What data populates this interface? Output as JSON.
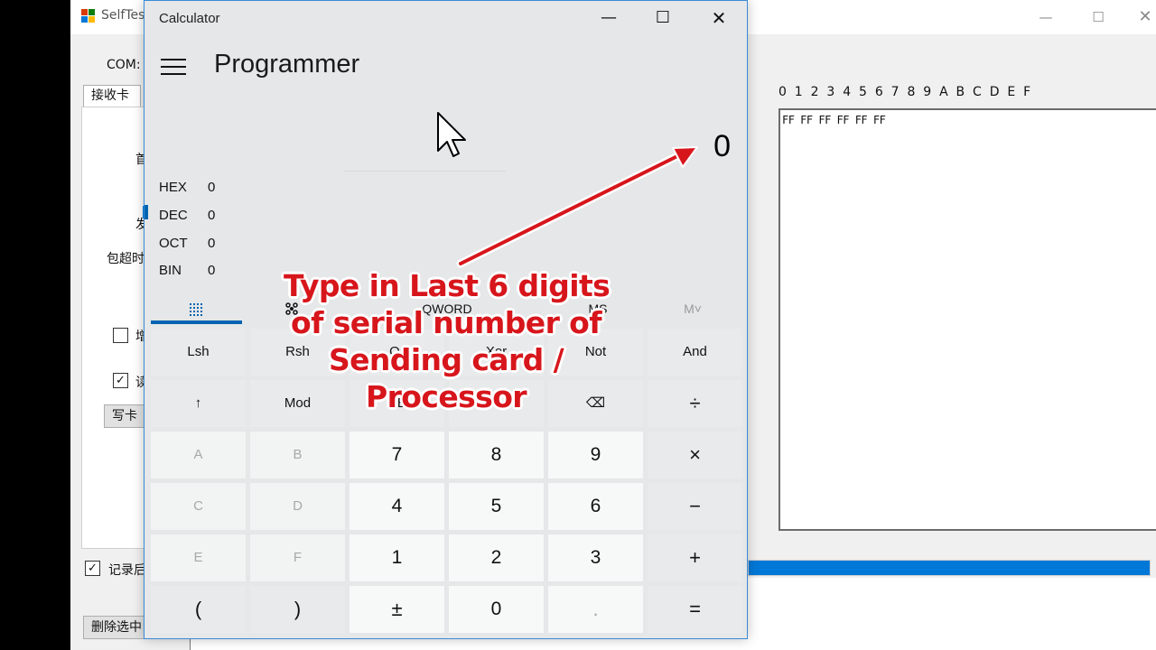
{
  "background_app": {
    "title": "SelfTes",
    "com_label": "COM:",
    "tab_label": "接收卡",
    "frag_1": "首",
    "frag_2": "发",
    "frag_3": "包超时",
    "frag_4": "增",
    "frag_5": "读",
    "check_1": "",
    "check_2": "✓",
    "write_button": "写卡",
    "record_label": "记录后",
    "record_check": "✓",
    "delete_button": "删除选中",
    "hex_header": "0  1  2  3  4  5  6  7  8  9  A  B  C  D  E  F",
    "hex_line": "FF FF FF FF FF FF",
    "progress_fraction": 1.0
  },
  "calculator": {
    "window_title": "Calculator",
    "mode_title": "Programmer",
    "display_value": "0",
    "radix": [
      {
        "name": "HEX",
        "value": "0"
      },
      {
        "name": "DEC",
        "value": "0"
      },
      {
        "name": "OCT",
        "value": "0"
      },
      {
        "name": "BIN",
        "value": "0"
      }
    ],
    "tabs": {
      "keypad_icon": "keypad-grid-icon",
      "bitpad_icon": "bit-toggle-icon",
      "word_size": "QWORD",
      "memory_store": "MS",
      "memory_list": "M˅"
    },
    "keys": [
      [
        "Lsh",
        "Rsh",
        "Or",
        "Xor",
        "Not",
        "And"
      ],
      [
        "↑",
        "Mod",
        "CE",
        "C",
        "⌫",
        "÷"
      ],
      [
        "A",
        "B",
        "7",
        "8",
        "9",
        "×"
      ],
      [
        "C",
        "D",
        "4",
        "5",
        "6",
        "−"
      ],
      [
        "E",
        "F",
        "1",
        "2",
        "3",
        "+"
      ],
      [
        "(",
        ")",
        "±",
        "0",
        ".",
        "="
      ]
    ]
  },
  "annotation": {
    "line1": "Type in Last 6 digits",
    "line2": "of serial number of",
    "line3": "Sending card /",
    "line4": "Processor",
    "color": "#d7161c"
  }
}
